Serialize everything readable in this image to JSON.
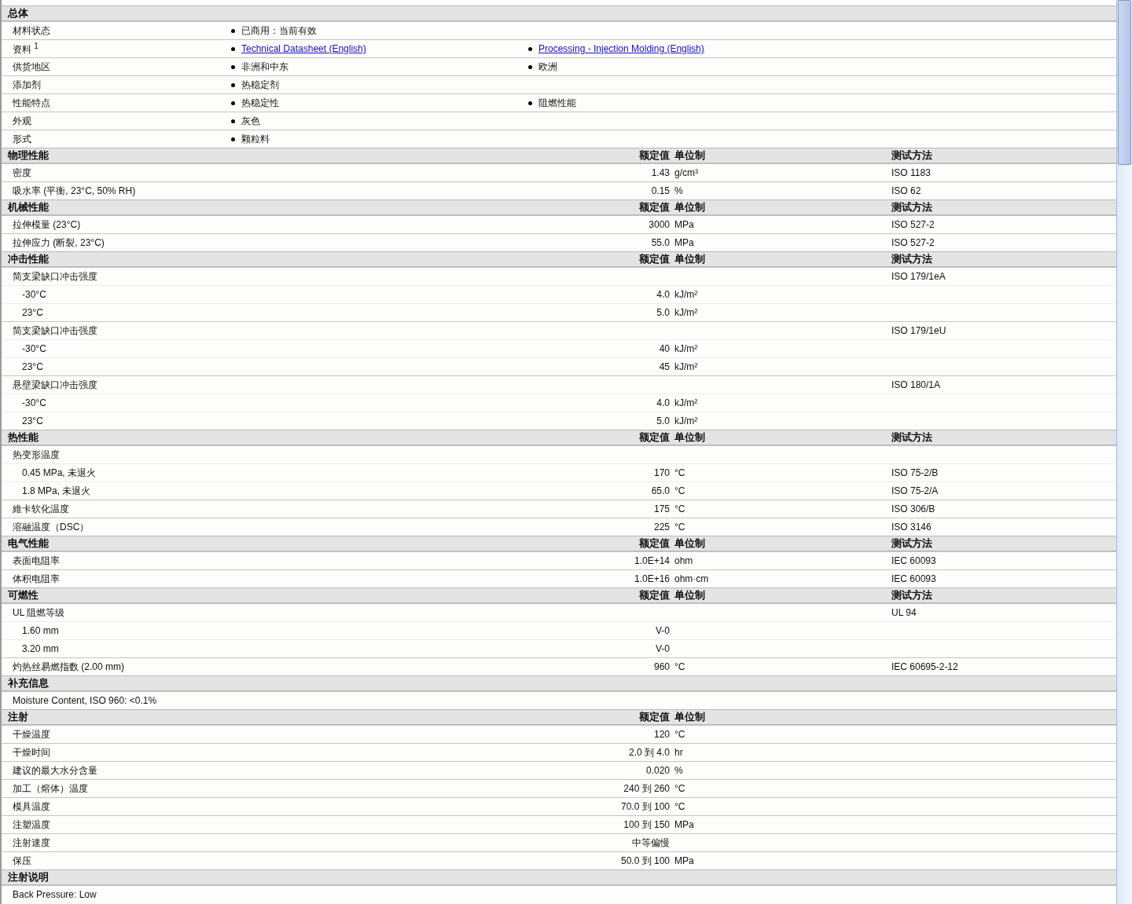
{
  "sections": [
    {
      "kind": "general",
      "title": "总体",
      "rows": [
        {
          "label": "材料状态",
          "items": [
            {
              "kind": "plain",
              "text": "已商用：当前有效"
            }
          ]
        },
        {
          "label": "资料 $^{1}$",
          "items": [
            {
              "kind": "link",
              "text": "Technical Datasheet (English)"
            },
            {
              "kind": "link",
              "text": "Processing - Injection Molding (English)"
            }
          ]
        },
        {
          "label": "供货地区",
          "items": [
            {
              "kind": "plain",
              "text": "非洲和中东"
            },
            {
              "kind": "plain",
              "text": "欧洲"
            }
          ]
        },
        {
          "label": "添加剂",
          "items": [
            {
              "kind": "plain",
              "text": "热稳定剂"
            }
          ]
        },
        {
          "label": "性能特点",
          "items": [
            {
              "kind": "plain",
              "text": "热稳定性"
            },
            {
              "kind": "plain",
              "text": "阻燃性能"
            }
          ]
        },
        {
          "label": "外观",
          "items": [
            {
              "kind": "plain",
              "text": "灰色"
            }
          ]
        },
        {
          "label": "形式",
          "items": [
            {
              "kind": "plain",
              "text": "颗粒料"
            }
          ]
        }
      ]
    },
    {
      "kind": "properties",
      "title": "物理性能",
      "columns": [
        "额定值",
        "单位制",
        "测试方法"
      ],
      "rows": [
        {
          "label": "密度",
          "value": "1.43",
          "unit": "g/cm³",
          "method": "ISO 1183"
        },
        {
          "label": "吸水率  (平衡, 23°C, 50% RH)",
          "value": "0.15",
          "unit": "%",
          "method": "ISO 62"
        }
      ]
    },
    {
      "kind": "properties",
      "title": "机械性能",
      "columns": [
        "额定值",
        "单位制",
        "测试方法"
      ],
      "rows": [
        {
          "label": "拉伸模量  (23°C)",
          "value": "3000",
          "unit": "MPa",
          "method": "ISO 527-2"
        },
        {
          "label": "拉伸应力  (断裂, 23°C)",
          "value": "55.0",
          "unit": "MPa",
          "method": "ISO 527-2"
        }
      ]
    },
    {
      "kind": "properties",
      "title": "冲击性能",
      "columns": [
        "额定值",
        "单位制",
        "测试方法"
      ],
      "rows": [
        {
          "label": "简支梁缺口冲击强度",
          "method": "ISO 179/1eA",
          "children": [
            {
              "label": "-30°C",
              "value": "4.0",
              "unit": "kJ/m²"
            },
            {
              "label": "23°C",
              "value": "5.0",
              "unit": "kJ/m²"
            }
          ]
        },
        {
          "label": "简支梁缺口冲击强度",
          "method": "ISO 179/1eU",
          "children": [
            {
              "label": "-30°C",
              "value": "40",
              "unit": "kJ/m²"
            },
            {
              "label": "23°C",
              "value": "45",
              "unit": "kJ/m²"
            }
          ]
        },
        {
          "label": "悬壁梁缺口冲击强度",
          "method": "ISO 180/1A",
          "children": [
            {
              "label": "-30°C",
              "value": "4.0",
              "unit": "kJ/m²"
            },
            {
              "label": "23°C",
              "value": "5.0",
              "unit": "kJ/m²"
            }
          ]
        }
      ]
    },
    {
      "kind": "properties",
      "title": "热性能",
      "columns": [
        "额定值",
        "单位制",
        "测试方法"
      ],
      "rows": [
        {
          "label": "热变形温度",
          "children": [
            {
              "label": "0.45 MPa, 未退火",
              "value": "170",
              "unit": "°C",
              "method": "ISO 75-2/B"
            },
            {
              "label": "1.8 MPa, 未退火",
              "value": "65.0",
              "unit": "°C",
              "method": "ISO 75-2/A"
            }
          ]
        },
        {
          "label": "維卡软化温度",
          "value": "175",
          "unit": "°C",
          "method": "ISO 306/B"
        },
        {
          "label": "溶融温度（DSC）",
          "value": "225",
          "unit": "°C",
          "method": "ISO 3146"
        }
      ]
    },
    {
      "kind": "properties",
      "title": "电气性能",
      "columns": [
        "额定值",
        "单位制",
        "测试方法"
      ],
      "rows": [
        {
          "label": "表面电阻率",
          "value": "1.0E+14",
          "unit": "ohm",
          "method": "IEC 60093"
        },
        {
          "label": "体积电阻率",
          "value": "1.0E+16",
          "unit": "ohm·cm",
          "method": "IEC 60093"
        }
      ]
    },
    {
      "kind": "properties",
      "title": "可燃性",
      "columns": [
        "额定值",
        "单位制",
        "测试方法"
      ],
      "rows": [
        {
          "label": "UL 阻燃等级",
          "method": "UL 94",
          "children": [
            {
              "label": "1.60 mm",
              "value": "V-0"
            },
            {
              "label": "3.20 mm",
              "value": "V-0"
            }
          ]
        },
        {
          "label": "灼热丝易燃指数  (2.00 mm)",
          "value": "960",
          "unit": "°C",
          "method": "IEC 60695-2-12"
        }
      ]
    },
    {
      "kind": "notes",
      "title": "补充信息",
      "rows": [
        {
          "text": "Moisture Content, ISO 960: <0.1%"
        }
      ]
    },
    {
      "kind": "properties",
      "title": "注射",
      "columns": [
        "额定值",
        "单位制"
      ],
      "rows": [
        {
          "label": "干燥温度",
          "value": "120",
          "unit": "°C"
        },
        {
          "label": "干燥时间",
          "value": "2.0 到  4.0",
          "unit": "hr"
        },
        {
          "label": "建议的最大水分含量",
          "value": "0.020",
          "unit": "%"
        },
        {
          "label": "加工（熔体）温度",
          "value": "240 到  260",
          "unit": "°C"
        },
        {
          "label": "模具温度",
          "value": "70.0 到  100",
          "unit": "°C"
        },
        {
          "label": "注塑温度",
          "value": "100 到  150",
          "unit": "MPa"
        },
        {
          "label": "注射速度",
          "value": "中等偏慢"
        },
        {
          "label": "保压",
          "value": "50.0 到  100",
          "unit": "MPa"
        }
      ]
    },
    {
      "kind": "notes",
      "title": "注射说明",
      "rows": [
        {
          "text": "Back Pressure: Low"
        }
      ]
    }
  ]
}
